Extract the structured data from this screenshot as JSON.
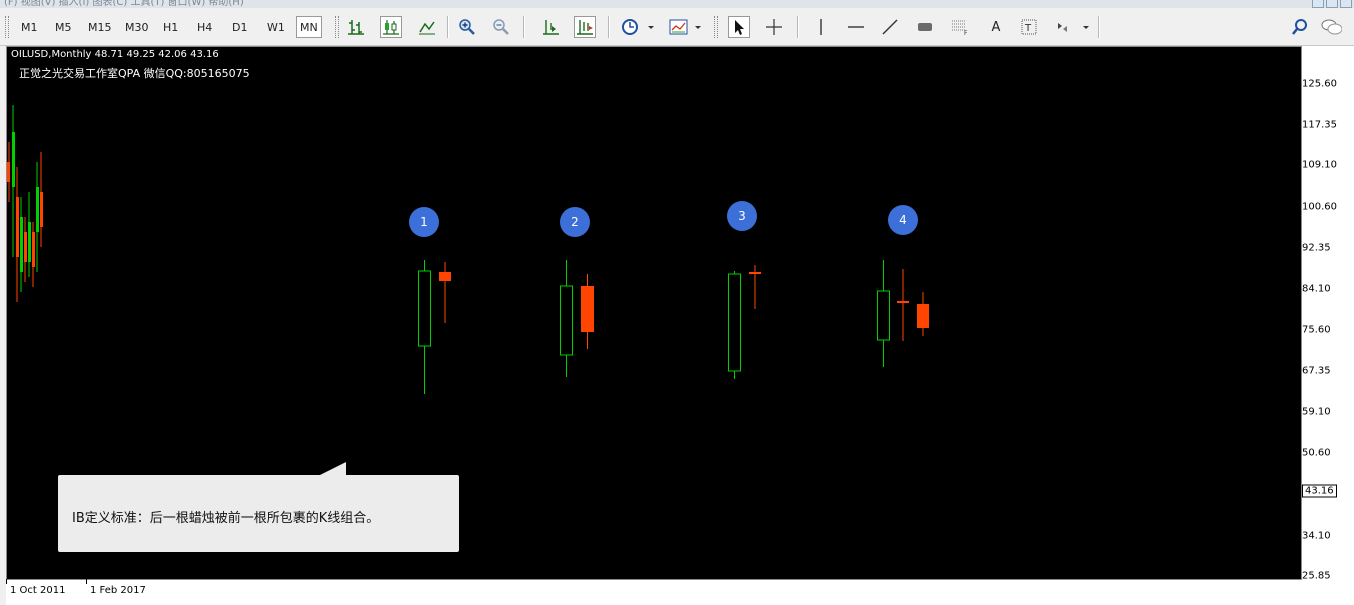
{
  "window": {
    "ghost_menu": "(F)  视图(V)  插入(I)  图表(C)  工具(T)  窗口(W)  帮助(H)"
  },
  "toolbar": {
    "timeframes": [
      "M1",
      "M5",
      "M15",
      "M30",
      "H1",
      "H4",
      "D1",
      "W1",
      "MN"
    ],
    "active_timeframe": "MN",
    "text_tool": "A",
    "tools": [
      "bar-chart-icon",
      "candle-chart-icon",
      "line-chart-icon",
      "zoom-in-icon",
      "zoom-out-icon",
      "chart-shift-icon",
      "autoscroll-icon",
      "periods-clock-icon",
      "templates-icon",
      "cursor-icon",
      "crosshair-icon",
      "vertical-line-icon",
      "horizontal-line-icon",
      "trendline-icon",
      "rectangle-icon",
      "fibonacci-icon",
      "text-icon",
      "text-label-icon",
      "arrows-icon",
      "search-icon",
      "chat-icon"
    ]
  },
  "chart": {
    "symbol_line": "OILUSD,Monthly  48.71 49.25 42.06 43.16",
    "watermark": "正觉之光交易工作室QPA 微信QQ:805165075",
    "current_price": "43.16",
    "price_ticks": [
      "125.60",
      "117.35",
      "109.10",
      "100.60",
      "92.35",
      "84.10",
      "75.60",
      "67.35",
      "59.10",
      "50.60",
      "34.10",
      "25.85"
    ],
    "time_ticks": [
      "1 Oct 2011",
      "1 Feb 2017"
    ],
    "badges": [
      "1",
      "2",
      "3",
      "4"
    ],
    "callout_text": "IB定义标准：后一根蜡烛被前一根所包裹的K线组合。",
    "colors": {
      "bull": "#00d000",
      "bear": "#ff4500",
      "background": "#000000",
      "badge": "#3d6fd8"
    }
  }
}
